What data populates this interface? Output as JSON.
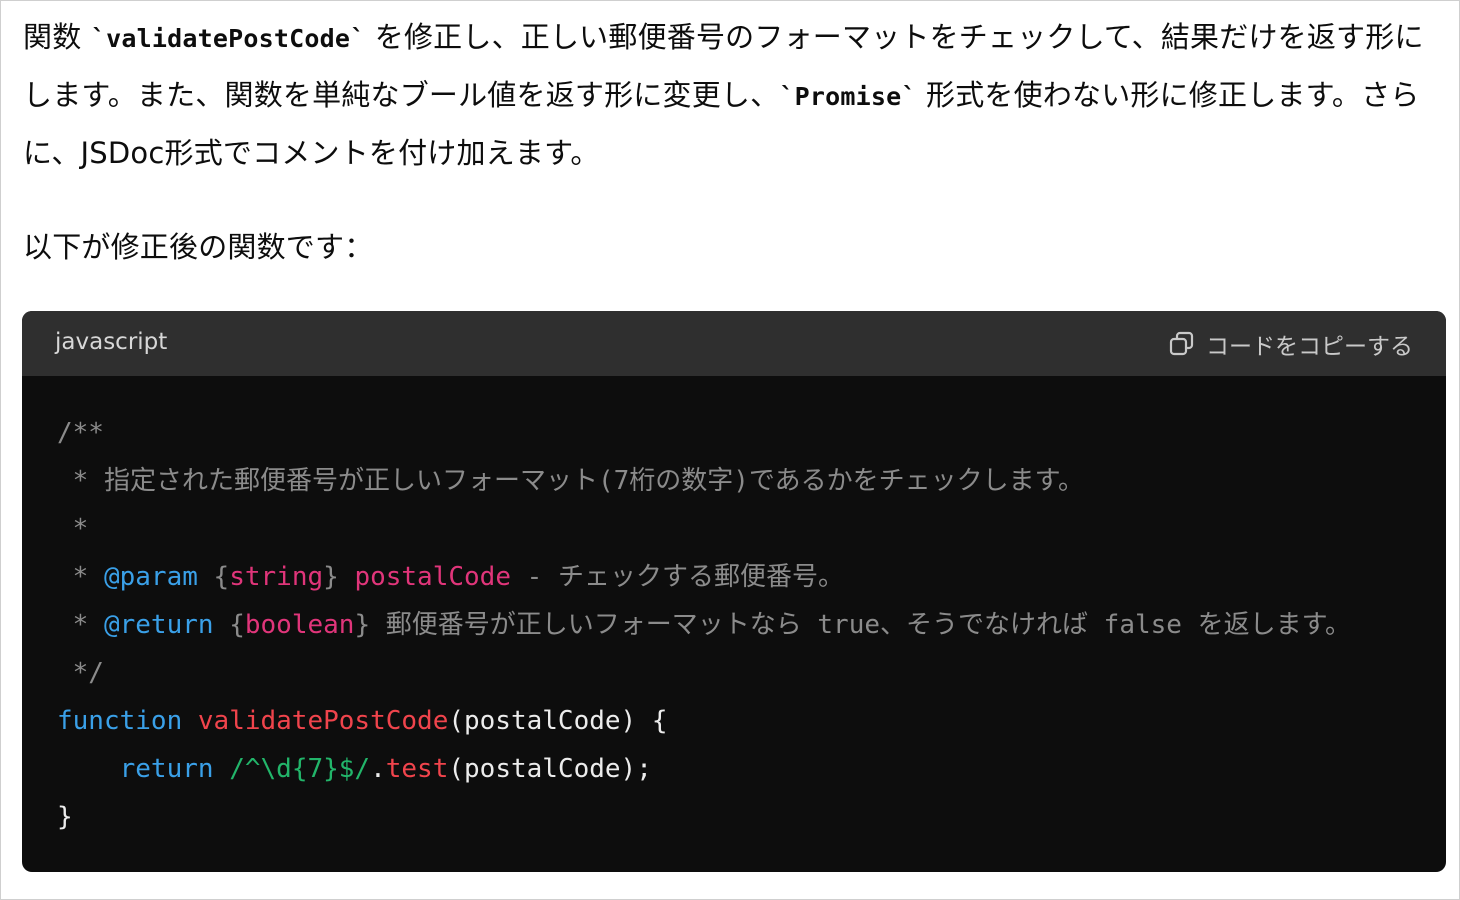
{
  "prose": {
    "p1_part1": "関数 ",
    "p1_code1": "`validatePostCode`",
    "p1_part2": " を修正し、正しい郵便番号のフォーマットをチェックして、結果だけを返す形にします。また、関数を単純なブール値を返す形に変更し、",
    "p1_code2": "`Promise`",
    "p1_part3": " 形式を使わない形に修正します。さらに、JSDoc形式でコメントを付け加えます。",
    "p2": "以下が修正後の関数です："
  },
  "code_block": {
    "language": "javascript",
    "copy_label": "コードをコピーする",
    "copy_icon": "copy-icon",
    "lines": {
      "l1": "/**",
      "l2": " * 指定された郵便番号が正しいフォーマット(7桁の数字)であるかをチェックします。",
      "l3": " *",
      "l4_star": " * ",
      "l4_tag": "@param",
      "l4_type_open": " {",
      "l4_type": "string",
      "l4_type_close": "} ",
      "l4_name": "postalCode",
      "l4_desc": " - チェックする郵便番号。",
      "l5_star": " * ",
      "l5_tag": "@return",
      "l5_type_open": " {",
      "l5_type": "boolean",
      "l5_type_close": "} ",
      "l5_desc": "郵便番号が正しいフォーマットなら true、そうでなければ false を返します。",
      "l6": " */",
      "l7_kw": "function",
      "l7_fn": "validatePostCode",
      "l7_rest": "(postalCode) {",
      "l8_indent": "    ",
      "l8_kw": "return",
      "l8_regex": "/^\\d{7}$/",
      "l8_dot": ".",
      "l8_fn": "test",
      "l8_rest": "(postalCode);",
      "l9": "}"
    }
  }
}
